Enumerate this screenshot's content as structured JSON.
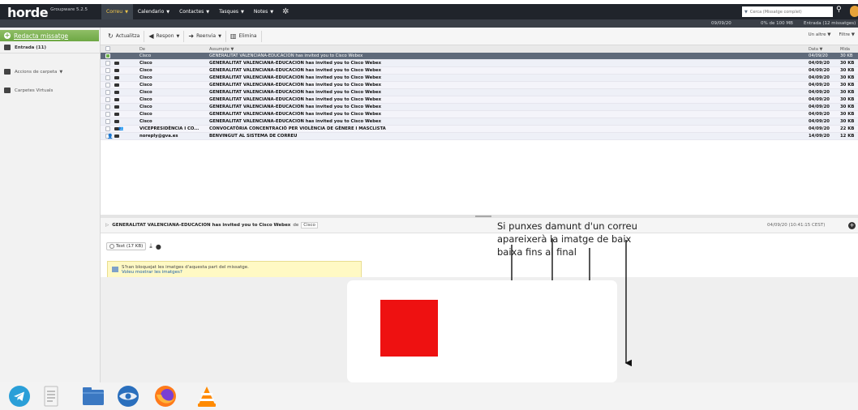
{
  "app": {
    "logo_word": "horde",
    "logo_version": "Groupware 5.2.5"
  },
  "topmenu": {
    "items": [
      {
        "label": "Correu",
        "active": true
      },
      {
        "label": "Calendario",
        "active": false
      },
      {
        "label": "Contactes",
        "active": false
      },
      {
        "label": "Tasques",
        "active": false
      },
      {
        "label": "Notes",
        "active": false
      }
    ],
    "search_placeholder": "Cerca (Missatge complet)"
  },
  "statusstrip": {
    "date": "09/09/20",
    "quota": "0% de 100 MB",
    "inbox_info": "Entrada (12 missatges)"
  },
  "sidebar": {
    "compose_label": "Redacta missatge",
    "inbox_label": "Entrada (11)",
    "folder_actions_label": "Accions de carpeta",
    "virtual_folders_label": "Carpetes Virtuals"
  },
  "toolbar": {
    "refresh": "Actualitza",
    "reply": "Respon",
    "forward": "Reenvia",
    "delete": "Elimina",
    "other": "Un altre",
    "filter": "Filtre"
  },
  "columns": {
    "from": "De",
    "subject": "Assumpte",
    "date": "Data",
    "size": "Mida"
  },
  "messages": [
    {
      "from": "Cisco",
      "subject": "GENERALITAT VALENCIANA-EDUCACION has invited you to Cisco Webex",
      "date": "04/09/20",
      "size": "30 KB",
      "state": "sel"
    },
    {
      "from": "Cisco",
      "subject": "GENERALITAT VALENCIANA-EDUCACION has invited you to Cisco Webex",
      "date": "04/09/20",
      "size": "30 KB",
      "state": "unread"
    },
    {
      "from": "Cisco",
      "subject": "GENERALITAT VALENCIANA-EDUCACION has invited you to Cisco Webex",
      "date": "04/09/20",
      "size": "30 KB",
      "state": "unread"
    },
    {
      "from": "Cisco",
      "subject": "GENERALITAT VALENCIANA-EDUCACION has invited you to Cisco Webex",
      "date": "04/09/20",
      "size": "30 KB",
      "state": "unread"
    },
    {
      "from": "Cisco",
      "subject": "GENERALITAT VALENCIANA-EDUCACION has invited you to Cisco Webex",
      "date": "04/09/20",
      "size": "30 KB",
      "state": "unread"
    },
    {
      "from": "Cisco",
      "subject": "GENERALITAT VALENCIANA-EDUCACION has invited you to Cisco Webex",
      "date": "04/09/20",
      "size": "30 KB",
      "state": "unread"
    },
    {
      "from": "Cisco",
      "subject": "GENERALITAT VALENCIANA-EDUCACION has invited you to Cisco Webex",
      "date": "04/09/20",
      "size": "30 KB",
      "state": "unread"
    },
    {
      "from": "Cisco",
      "subject": "GENERALITAT VALENCIANA-EDUCACION has invited you to Cisco Webex",
      "date": "04/09/20",
      "size": "30 KB",
      "state": "unread"
    },
    {
      "from": "Cisco",
      "subject": "GENERALITAT VALENCIANA-EDUCACION has invited you to Cisco Webex",
      "date": "04/09/20",
      "size": "30 KB",
      "state": "unread"
    },
    {
      "from": "Cisco",
      "subject": "GENERALITAT VALENCIANA-EDUCACION has invited you to Cisco Webex",
      "date": "04/09/20",
      "size": "30 KB",
      "state": "unread"
    },
    {
      "from": "VICEPRESIDÈNCIA I CO...",
      "subject": "CONVOCATÒRIA CONCENTRACIÓ PER VIOLÈNCIA DE GÈNERE I MASCLISTA",
      "date": "04/09/20",
      "size": "22 KB",
      "state": "unread"
    },
    {
      "from": "noreply@gva.es",
      "subject": "BENVINGUT AL SISTEMA DE CORREU",
      "date": "14/09/20",
      "size": "12 KB",
      "state": "unread"
    }
  ],
  "preview": {
    "subject": "GENERALITAT VALENCIANA-EDUCACION has invited you to Cisco Webex",
    "de": "de",
    "from": "Cisco",
    "date": "04/09/20 (10:41:15 CEST)",
    "part_label": "Text (17 KB)",
    "warning_line1": "S'han bloquejat les imatges d'aquesta part del missatge.",
    "warning_line2": "Voleu mostrar les imatges?"
  },
  "annotation": {
    "line1": "Si punxes damunt d'un correu",
    "line2": "apareixerà la imatge de baix",
    "line3": "baixa fins al final"
  },
  "colors": {
    "topbar": "#20242b",
    "active_menu_text": "#f4c84a",
    "compose_green": "#6ea844",
    "selected_row": "#5f6a7a",
    "red_square": "#ee1111"
  },
  "taskbar": {
    "apps": [
      "telegram-icon",
      "text-editor-icon",
      "files-icon",
      "thunderbird-icon",
      "firefox-icon",
      "vlc-icon"
    ]
  }
}
